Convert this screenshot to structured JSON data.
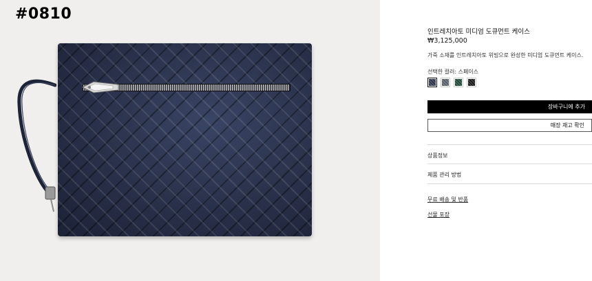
{
  "image": {
    "product_code": "#0810"
  },
  "product": {
    "title": "인트레치아토 미디엄 도큐먼트 케이스",
    "price": "₩3,125,000",
    "description": "가죽 소재를 인트레치아토 위빙으로 완성한 미디엄 도큐먼트 케이스.",
    "selected_color_label": "선택한 컬러: 스페이스",
    "swatches": [
      {
        "name": "space",
        "color": "#2b3550",
        "selected": true
      },
      {
        "name": "grey",
        "color": "#5a5f68",
        "selected": false
      },
      {
        "name": "green",
        "color": "#1f4a3a",
        "selected": false
      },
      {
        "name": "black",
        "color": "#1b1b1b",
        "selected": false
      }
    ]
  },
  "actions": {
    "add_to_cart": "장바구니에 추가",
    "check_store_stock": "매장 재고 확인"
  },
  "sections": {
    "product_info": "상품정보",
    "care": "제품 관리 방법"
  },
  "links": {
    "shipping_returns": "무료 배송 및 반품",
    "gift_wrap": "선물 포장"
  }
}
